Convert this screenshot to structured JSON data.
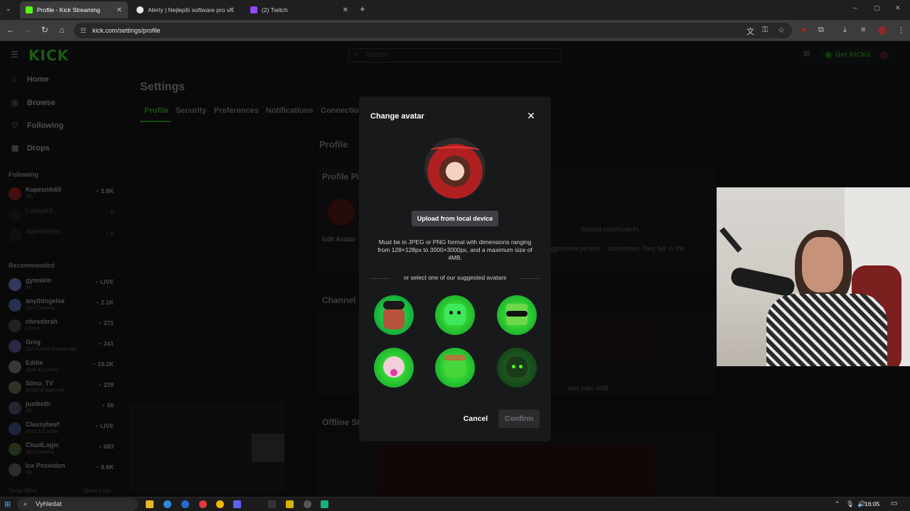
{
  "browser": {
    "tabs": [
      {
        "title": "Profile - Kick Streaming",
        "active": true
      },
      {
        "title": "Alerty | Nejlepší software pro v...",
        "active": false
      },
      {
        "title": "(2) Twitch",
        "active": false
      }
    ],
    "url": "kick.com/settings/profile"
  },
  "kick": {
    "logo": "KICK",
    "search_placeholder": "Search",
    "get_kicks": "Get KICKs",
    "nav": [
      {
        "label": "Home",
        "icon": "home-icon"
      },
      {
        "label": "Browse",
        "icon": "compass-icon"
      },
      {
        "label": "Following",
        "icon": "heart-icon"
      },
      {
        "label": "Drops",
        "icon": "drops-icon"
      }
    ],
    "following_header": "Following",
    "following": [
      {
        "name": "Kapesnik69",
        "game": "IRL",
        "count": "2.8K"
      },
      {
        "name": "LukasKS",
        "game": "",
        "count": "0"
      },
      {
        "name": "Agwinktyes",
        "game": "",
        "count": "0"
      }
    ],
    "recommended_header": "Recommended",
    "recommended": [
      {
        "name": "gymskin",
        "game": "IRL",
        "count": "LIVE"
      },
      {
        "name": "anythingelse",
        "game": "Just Chatting",
        "count": "2.1K"
      },
      {
        "name": "chessbrah",
        "game": "Chess",
        "count": "271"
      },
      {
        "name": "Greg",
        "game": "Old School RuneScape",
        "count": "241"
      },
      {
        "name": "Eddie",
        "game": "Slots & Casino",
        "count": "19.2K"
      },
      {
        "name": "Stino_TV",
        "game": "World of Warcraft",
        "count": "228"
      },
      {
        "name": "justketh",
        "game": "IRL",
        "count": "56"
      },
      {
        "name": "Classybeef",
        "game": "Slots & Casino",
        "count": "LIVE"
      },
      {
        "name": "ChudLogic",
        "game": "Just Chatting",
        "count": "683"
      },
      {
        "name": "Ice Poseidon",
        "game": "IRL",
        "count": "8.6K"
      }
    ],
    "show_more": "Show More",
    "show_less": "Show Less",
    "settings_title": "Settings",
    "settings_tabs": [
      "Profile",
      "Security",
      "Preferences",
      "Notifications",
      "Connections"
    ],
    "section_profile": "Profile",
    "profile_picture": "Profile Picture",
    "edit_avatar": "Edit Avatar",
    "discord": "discord.com/invite/H...",
    "bio_snippet": "ggressive person ... sometimes They live in the",
    "channel": "Channel",
    "size_note": "less than 4MB",
    "offline": "Offline St"
  },
  "modal": {
    "title": "Change avatar",
    "upload_label": "Upload from local device",
    "requirements": "Must be in JPEG or PNG format with dimensions ranging from 128×128px to 3000×3000px, and a maximum size of 4MB.",
    "suggest_label": "or select one of our suggested avatars",
    "cancel": "Cancel",
    "confirm": "Confirm",
    "avatar_colors": [
      "#53fc18",
      "#53fc18",
      "#53fc18",
      "#53fc18",
      "#53fc18",
      "#53fc18"
    ]
  },
  "taskbar": {
    "search": "Vyhledat",
    "time": "16:05"
  },
  "colors": {
    "kick_green": "#53fc18",
    "modal_bg": "#18191b"
  }
}
